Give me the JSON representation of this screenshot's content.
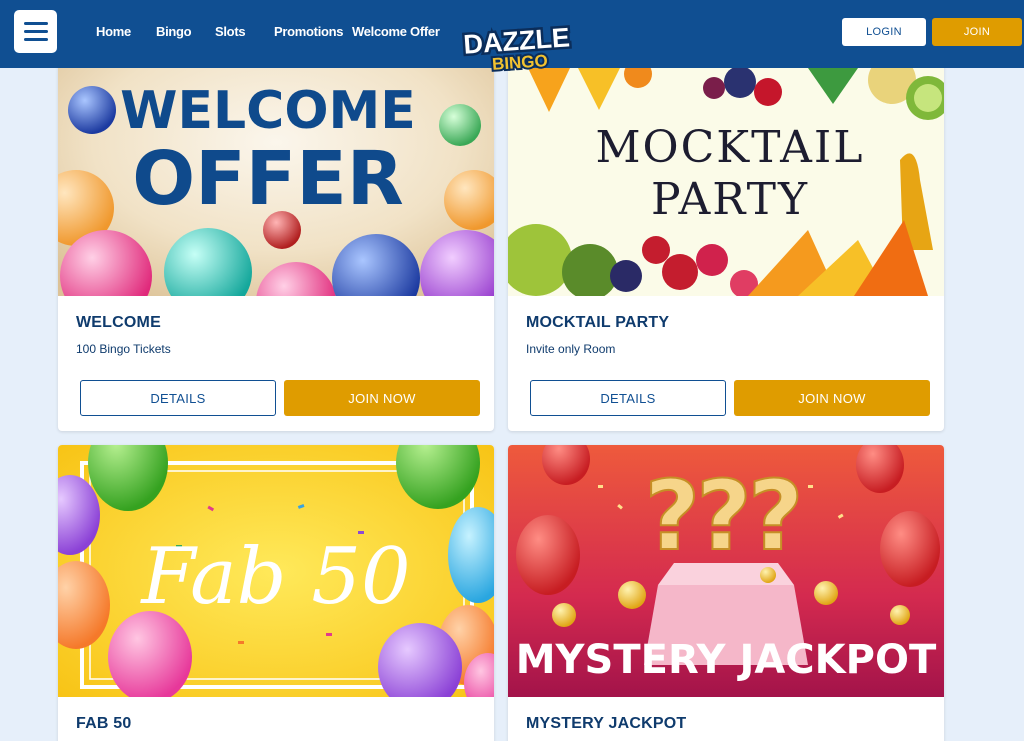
{
  "header": {
    "nav": [
      "Home",
      "Bingo",
      "Slots",
      "Promotions",
      "Welcome Offer"
    ],
    "logo_top": "DAZZLE",
    "logo_bottom": "BINGO",
    "login_label": "LOGIN",
    "join_label": "JOIN"
  },
  "cards": [
    {
      "title": "WELCOME",
      "subtitle": "100 Bingo Tickets",
      "details_label": "DETAILS",
      "join_label": "JOIN NOW",
      "banner_line1": "WELCOME",
      "banner_line2": "OFFER"
    },
    {
      "title": "MOCKTAIL PARTY",
      "subtitle": "Invite only Room",
      "details_label": "DETAILS",
      "join_label": "JOIN NOW",
      "banner_line1": "MOCKTAIL",
      "banner_line2": "PARTY"
    },
    {
      "title": "FAB 50",
      "banner_line1": "Fab 50"
    },
    {
      "title": "MYSTERY JACKPOT",
      "banner_line1": "MYSTERY JACKPOT"
    }
  ],
  "colors": {
    "brand_blue": "#104f92",
    "accent_gold": "#df9c00",
    "page_bg": "#e6effa",
    "title_text": "#0f3b6d"
  }
}
